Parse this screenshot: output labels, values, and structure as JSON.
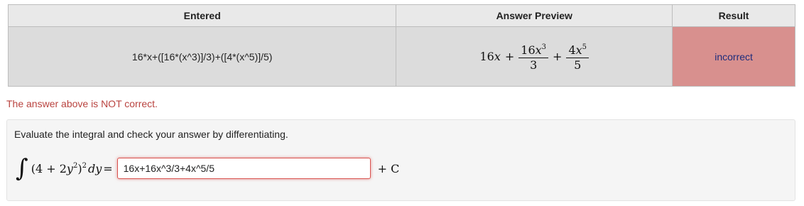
{
  "table": {
    "headers": {
      "entered": "Entered",
      "preview": "Answer Preview",
      "result": "Result"
    },
    "row": {
      "entered": "16*x+([16*(x^3)]/3)+([4*(x^5)]/5)",
      "preview": {
        "term1": "16",
        "term1_var": "x",
        "plus1": "+",
        "frac1_num": "16",
        "frac1_var": "x",
        "frac1_exp": "3",
        "frac1_den": "3",
        "plus2": "+",
        "frac2_num": "4",
        "frac2_var": "x",
        "frac2_exp": "5",
        "frac2_den": "5"
      },
      "result": "incorrect"
    }
  },
  "feedback": "The answer above is NOT correct.",
  "problem": {
    "instructions": "Evaluate the integral and check your answer by differentiating.",
    "integral_sign": "∫",
    "integrand_open": "(4 + 2",
    "integrand_var": "y",
    "integrand_inner_exp": "2",
    "integrand_close": ")",
    "integrand_outer_exp": "2",
    "differential": "dy",
    "equals": "=",
    "answer_value": "16x+16x^3/3+4x^5/5",
    "constant": "+ C"
  },
  "colors": {
    "result_incorrect_bg": "#d8908e",
    "feedback_text": "#b9433f",
    "input_error_border": "#d9534f"
  }
}
